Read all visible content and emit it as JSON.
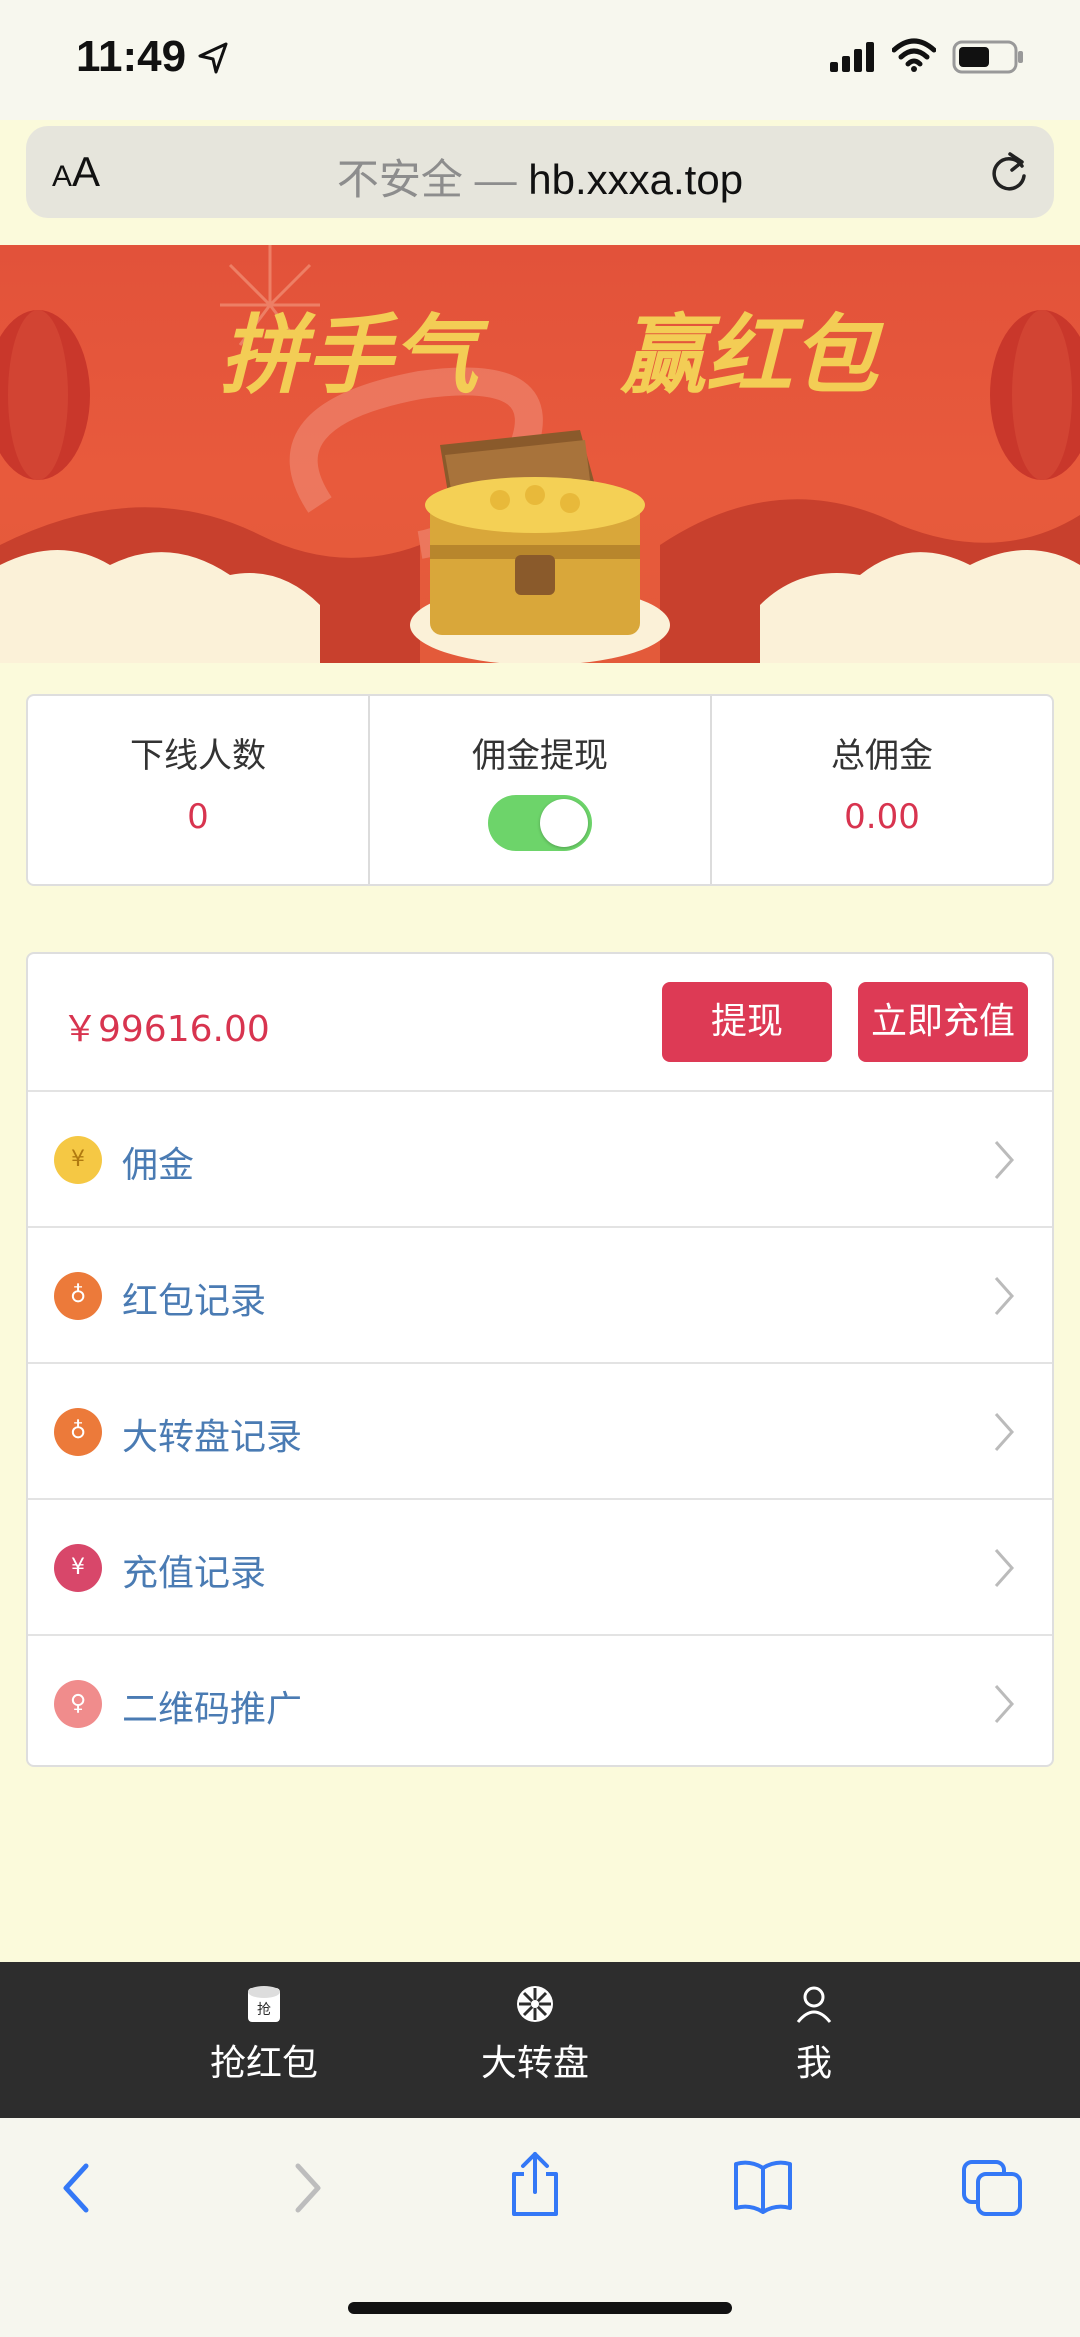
{
  "status_bar": {
    "time": "11:49"
  },
  "browser": {
    "aa_small": "A",
    "aa_large": "A",
    "insecure_label": "不安全 —",
    "domain": "hb.xxxa.top"
  },
  "banner": {
    "slogan_left": "拼手气",
    "slogan_right": "赢红包"
  },
  "stats": [
    {
      "label": "下线人数",
      "value": "0"
    },
    {
      "label": "佣金提现",
      "toggle_on": true
    },
    {
      "label": "总佣金",
      "value": "0.00"
    }
  ],
  "wallet": {
    "balance": "￥99616.00",
    "withdraw_label": "提现",
    "recharge_label": "立即充值"
  },
  "menu": [
    {
      "label": "佣金",
      "icon": "yen-coin-icon",
      "icon_text": "¥",
      "color": "#f5c844"
    },
    {
      "label": "红包记录",
      "icon": "money-bag-icon",
      "icon_text": "♁",
      "color": "#ec7a3a"
    },
    {
      "label": "大转盘记录",
      "icon": "money-bag-icon",
      "icon_text": "♁",
      "color": "#ec7a3a"
    },
    {
      "label": "充值记录",
      "icon": "yen-icon",
      "icon_text": "¥",
      "color": "#d8476a"
    },
    {
      "label": "二维码推广",
      "icon": "user-icon",
      "icon_text": "♀",
      "color": "#f08c8c"
    }
  ],
  "tabbar": [
    {
      "label": "抢红包",
      "icon": "red-envelope-icon",
      "icon_text": "抢"
    },
    {
      "label": "大转盘",
      "icon": "wheel-icon"
    },
    {
      "label": "我",
      "icon": "person-icon"
    }
  ],
  "colors": {
    "accent": "#dd3a55",
    "link": "#4a7bb3",
    "background": "#fbfadb"
  }
}
